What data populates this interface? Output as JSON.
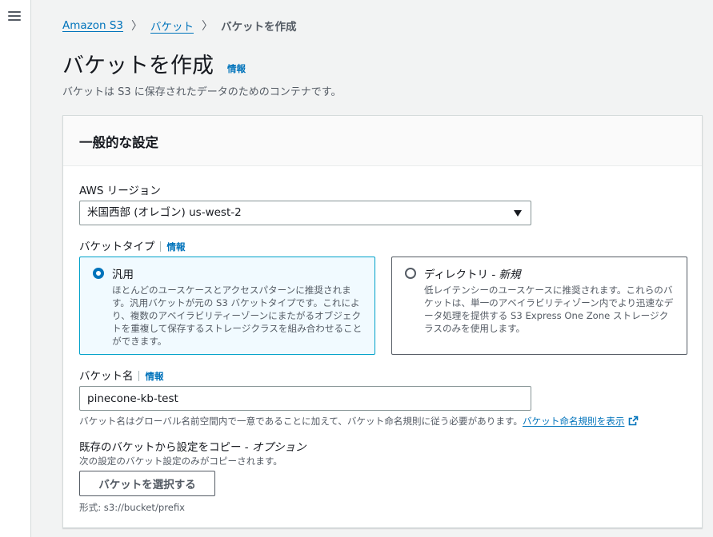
{
  "breadcrumb": {
    "items": [
      "Amazon S3",
      "バケット"
    ],
    "current": "バケットを作成"
  },
  "header": {
    "title": "バケットを作成",
    "info": "情報",
    "description": "バケットは S3 に保存されたデータのためのコンテナです。"
  },
  "general": {
    "title": "一般的な設定",
    "region_label": "AWS リージョン",
    "region_value": "米国西部 (オレゴン) us-west-2",
    "bucket_type_label": "バケットタイプ",
    "bucket_type_info": "情報",
    "types": [
      {
        "title": "汎用",
        "description": "ほとんどのユースケースとアクセスパターンに推奨されます。汎用バケットが元の S3 バケットタイプです。これにより、複数のアベイラビリティーゾーンにまたがるオブジェクトを重複して保存するストレージクラスを組み合わせることができます。",
        "selected": true
      },
      {
        "title": "ディレクトリ - ",
        "title_suffix": "新規",
        "description": "低レイテンシーのユースケースに推奨されます。これらのバケットは、単一のアベイラビリティゾーン内でより迅速なデータ処理を提供する S3 Express One Zone ストレージクラスのみを使用します。",
        "selected": false
      }
    ],
    "bucket_name_label": "バケット名",
    "bucket_name_info": "情報",
    "bucket_name_value": "pinecone-kb-test",
    "bucket_name_hint": "バケット名はグローバル名前空間内で一意であることに加えて、バケット命名規則に従う必要があります。",
    "naming_rules_link": "バケット命名規則を表示",
    "copy_label": "既存のバケットから設定をコピー - ",
    "copy_label_suffix": "オプション",
    "copy_hint": "次の設定のバケット設定のみがコピーされます。",
    "choose_button": "バケットを選択する",
    "format_hint": "形式: s3://bucket/prefix"
  },
  "colors": {
    "link": "#0073bb",
    "selected_border": "#00a1c9",
    "selected_bg": "#f1faff"
  }
}
